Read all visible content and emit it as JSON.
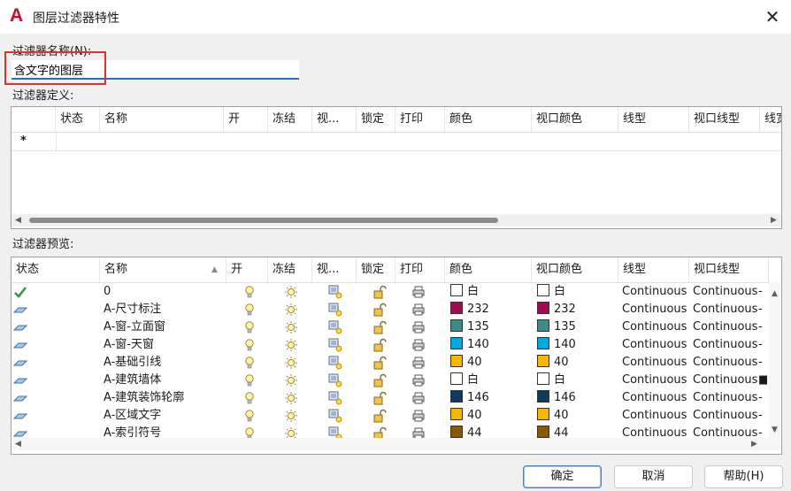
{
  "window": {
    "title": "图层过滤器特性",
    "app_logo": "A",
    "close_glyph": "✕"
  },
  "filter_name": {
    "label": "过滤器名称(N):",
    "value": "含文字的图层"
  },
  "definition": {
    "label": "过滤器定义:",
    "columns": [
      "状态",
      "名称",
      "开",
      "冻结",
      "视...",
      "锁定",
      "打印",
      "颜色",
      "视口颜色",
      "线型",
      "视口线型",
      "线宽"
    ],
    "new_row_marker": "*"
  },
  "preview": {
    "label": "过滤器预览:",
    "columns": [
      "状态",
      "名称",
      "开",
      "冻结",
      "视...",
      "锁定",
      "打印",
      "颜色",
      "视口颜色",
      "线型",
      "视口线型"
    ],
    "rows": [
      {
        "status": "current",
        "name": "0",
        "color_hex": "#ffffff",
        "color": "白",
        "vp_color_hex": "#ffffff",
        "vp_color": "白",
        "linetype": "Continuous",
        "vp_linetype": "Continuous",
        "vp_tail": "-"
      },
      {
        "status": "layer",
        "name": "A-尺寸标注",
        "color_hex": "#9e0b52",
        "color": "232",
        "vp_color_hex": "#9e0b52",
        "vp_color": "232",
        "linetype": "Continuous",
        "vp_linetype": "Continuous",
        "vp_tail": "-"
      },
      {
        "status": "layer",
        "name": "A-窗-立面窗",
        "color_hex": "#3f8a86",
        "color": "135",
        "vp_color_hex": "#3f8a86",
        "vp_color": "135",
        "linetype": "Continuous",
        "vp_linetype": "Continuous",
        "vp_tail": "-"
      },
      {
        "status": "layer",
        "name": "A-窗-天窗",
        "color_hex": "#00a8e8",
        "color": "140",
        "vp_color_hex": "#00a8e8",
        "vp_color": "140",
        "linetype": "Continuous",
        "vp_linetype": "Continuous",
        "vp_tail": "-"
      },
      {
        "status": "layer",
        "name": "A-基础引线",
        "color_hex": "#f5b700",
        "color": "40",
        "vp_color_hex": "#f5b700",
        "vp_color": "40",
        "linetype": "Continuous",
        "vp_linetype": "Continuous",
        "vp_tail": "-"
      },
      {
        "status": "layer",
        "name": "A-建筑墙体",
        "color_hex": "#ffffff",
        "color": "白",
        "vp_color_hex": "#ffffff",
        "vp_color": "白",
        "linetype": "Continuous",
        "vp_linetype": "Continuous",
        "vp_tail": "■"
      },
      {
        "status": "layer",
        "name": "A-建筑装饰轮廓",
        "color_hex": "#0f3a5a",
        "color": "146",
        "vp_color_hex": "#0f3a5a",
        "vp_color": "146",
        "linetype": "Continuous",
        "vp_linetype": "Continuous",
        "vp_tail": "-"
      },
      {
        "status": "layer",
        "name": "A-区域文字",
        "color_hex": "#f5b700",
        "color": "40",
        "vp_color_hex": "#f5b700",
        "vp_color": "40",
        "linetype": "Continuous",
        "vp_linetype": "Continuous",
        "vp_tail": "-"
      },
      {
        "status": "layer",
        "name": "A-索引符号",
        "color_hex": "#8a5a00",
        "color": "44",
        "vp_color_hex": "#8a5a00",
        "vp_color": "44",
        "linetype": "Continuous",
        "vp_linetype": "Continuous",
        "vp_tail": "-"
      }
    ],
    "sort_glyph": "▲"
  },
  "buttons": {
    "ok": "确定",
    "cancel": "取消",
    "help": "帮助(H)"
  },
  "icons": {
    "current": "check-icon",
    "layer": "layer-icon",
    "on": "lightbulb-icon",
    "freeze": "sun-icon",
    "vp_freeze": "vp-freeze-icon",
    "lock": "unlock-icon",
    "plot": "printer-icon"
  },
  "colors": {
    "accent": "#2b6cbf",
    "highlight": "#e03030"
  }
}
